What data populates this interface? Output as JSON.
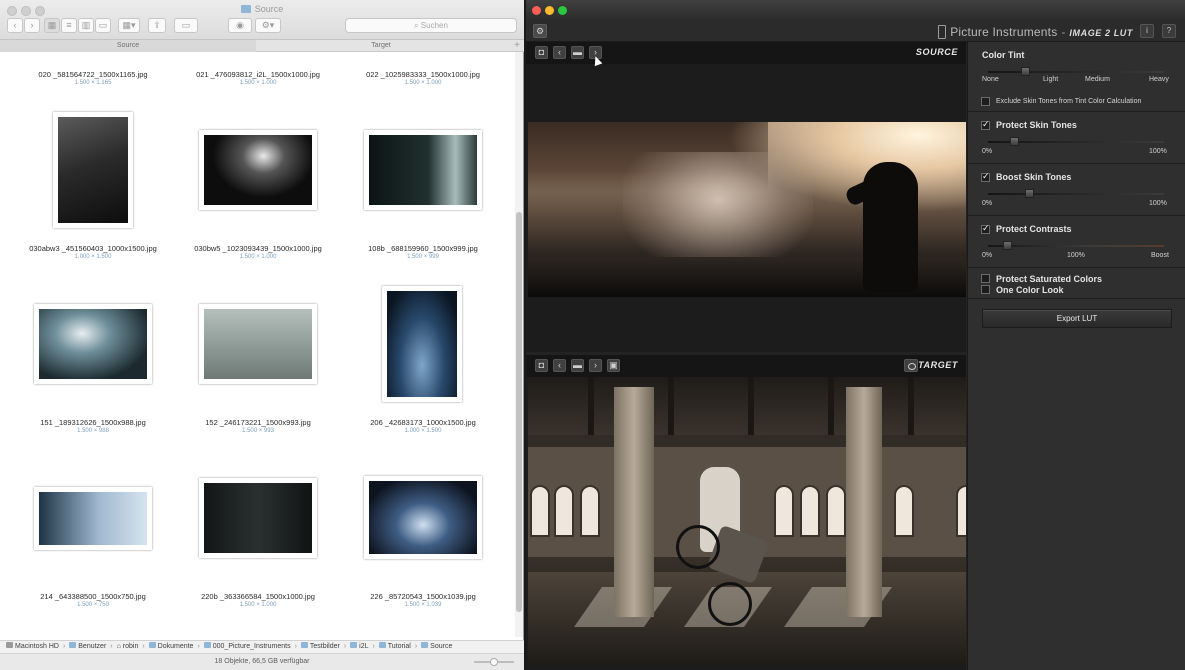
{
  "finder": {
    "title": "Source",
    "search_placeholder": "Suchen",
    "tabs": [
      "Source",
      "Target"
    ],
    "tab_add": "+",
    "items": [
      {
        "name": "020 _581564722_1500x1165.jpg",
        "dim": "1.500 × 1.165",
        "bg": "#ffffff"
      },
      {
        "name": "021 _476093812_i2L_1500x1000.jpg",
        "dim": "1.500 × 1.000",
        "bg": "#ffffff"
      },
      {
        "name": "022 _1025983333_1500x1000.jpg",
        "dim": "1.500 × 1.000",
        "bg": "#ffffff"
      },
      {
        "name": "030abw3 _451560403_1000x1500.jpg",
        "dim": "1.000 × 1.500",
        "bg": "linear-gradient(160deg,#5b5b5b,#2b2b2b 45%,#0d0d0d)"
      },
      {
        "name": "030bw5 _1023093439_1500x1000.jpg",
        "dim": "1.500 × 1.000",
        "bg": "radial-gradient(ellipse at 55% 30%,#e9e9e9 0%,#555 25%,#0d0d0d 60%)"
      },
      {
        "name": "108b _688159960_1500x999.jpg",
        "dim": "1.500 × 999",
        "bg": "linear-gradient(90deg,#0b1414,#20302f 55%,#a8bcba 80%,#2a3a38)"
      },
      {
        "name": "151 _189312626_1500x988.jpg",
        "dim": "1.500 × 988",
        "bg": "radial-gradient(ellipse at 40% 35%,#e7eef1 0%,#6f8f9a 30%,#1c2a30 75%)"
      },
      {
        "name": "152 _246173221_1500x993.jpg",
        "dim": "1.500 × 993",
        "bg": "linear-gradient(180deg,#b6c0bc,#8c9994 55%,#6f7a76)"
      },
      {
        "name": "206 _42683173_1000x1500.jpg",
        "dim": "1.000 × 1.500",
        "bg": "radial-gradient(ellipse at 50% 70%,#7fa6c9 0%,#28496b 45%,#0a1522 85%)"
      },
      {
        "name": "214 _643388500_1500x750.jpg",
        "dim": "1.500 × 750",
        "bg": "linear-gradient(90deg,#1e3446,#9fb8cf 55%,#d6e3ee)"
      },
      {
        "name": "220b _363366584_1500x1000.jpg",
        "dim": "1.500 × 1.000",
        "bg": "linear-gradient(90deg,#131616,#2a3030 50%,#111313)"
      },
      {
        "name": "226 _85720543_1500x1039.jpg",
        "dim": "1.500 × 1.039",
        "bg": "radial-gradient(ellipse at 50% 60%,#cfe1f2 0%,#3f5d84 35%,#0d1420 80%)"
      }
    ],
    "path": [
      "Macintosh HD",
      "Benutzer",
      "robin",
      "Dokumente",
      "000_Picture_Instruments",
      "Testbilder",
      "i2L",
      "Tutorial",
      "Source"
    ],
    "status": "18 Objekte, 66,5 GB verfügbar"
  },
  "app": {
    "brand": "Picture Instruments",
    "brand_sep": "-",
    "product": "IMAGE 2 LUT",
    "source_label": "SOURCE",
    "target_label": "TARGET",
    "panel": {
      "color_tint": {
        "title": "Color Tint",
        "scale": [
          "None",
          "Light",
          "Medium",
          "Heavy"
        ],
        "value": 0.2,
        "exclude_label": "Exclude Skin Tones from Tint Color Calculation",
        "exclude_checked": false
      },
      "protect_skin": {
        "label": "Protect Skin Tones",
        "checked": true,
        "min": "0%",
        "max": "100%",
        "value": 0.13
      },
      "boost_skin": {
        "label": "Boost Skin Tones",
        "checked": true,
        "min": "0%",
        "max": "100%",
        "value": 0.22
      },
      "protect_contrasts": {
        "label": "Protect Contrasts",
        "checked": true,
        "min": "0%",
        "mid": "100%",
        "max": "Boost",
        "value": 0.09
      },
      "protect_saturated": {
        "label": "Protect Saturated Colors",
        "checked": false
      },
      "one_color": {
        "label": "One Color Look",
        "checked": false
      },
      "export_label": "Export LUT"
    }
  }
}
